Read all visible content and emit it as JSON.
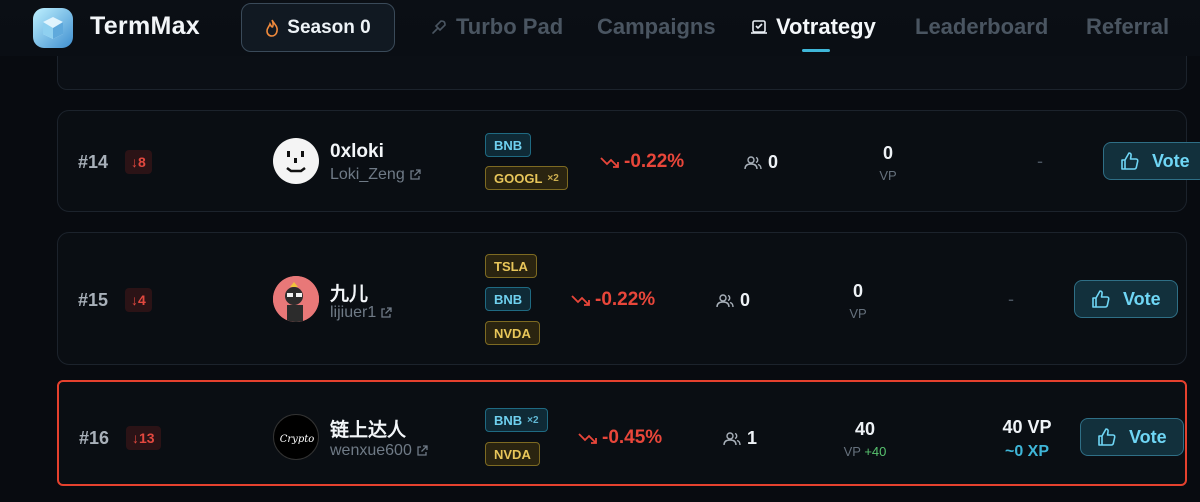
{
  "app": {
    "name": "TermMax"
  },
  "season": {
    "label": "Season 0"
  },
  "nav": [
    {
      "label": "Turbo Pad",
      "icon": "rocket-icon",
      "active": false
    },
    {
      "label": "Campaigns",
      "icon": "",
      "active": false
    },
    {
      "label": "Votrategy",
      "icon": "ballot-icon",
      "active": true
    },
    {
      "label": "Leaderboard",
      "icon": "",
      "active": false
    },
    {
      "label": "Referral",
      "icon": "",
      "active": false
    }
  ],
  "rows": [
    {
      "rank": "#14",
      "delta": "↓8",
      "name": "0xloki",
      "handle": "Loki_Zeng",
      "tags": [
        {
          "label": "BNB",
          "mult": "",
          "color": "blue"
        },
        {
          "label": "GOOGL",
          "mult": "×2",
          "color": "yellow"
        }
      ],
      "performance": "-0.22%",
      "voters": "0",
      "vp": "0",
      "vp_label": "VP",
      "vp_plus": "",
      "my_vp": "-",
      "my_xp": "",
      "vote_label": "Vote"
    },
    {
      "rank": "#15",
      "delta": "↓4",
      "name": "九儿",
      "handle": "lijiuer1",
      "tags": [
        {
          "label": "TSLA",
          "mult": "",
          "color": "yellow"
        },
        {
          "label": "BNB",
          "mult": "",
          "color": "blue"
        },
        {
          "label": "NVDA",
          "mult": "",
          "color": "yellow"
        }
      ],
      "performance": "-0.22%",
      "voters": "0",
      "vp": "0",
      "vp_label": "VP",
      "vp_plus": "",
      "my_vp": "-",
      "my_xp": "",
      "vote_label": "Vote"
    },
    {
      "rank": "#16",
      "delta": "↓13",
      "name": "链上达人",
      "handle": "wenxue600",
      "avatar_text": "Crypto",
      "tags": [
        {
          "label": "BNB",
          "mult": "×2",
          "color": "blue"
        },
        {
          "label": "NVDA",
          "mult": "",
          "color": "yellow"
        }
      ],
      "performance": "-0.45%",
      "voters": "1",
      "vp": "40",
      "vp_label": "VP",
      "vp_plus": "+40",
      "my_vp": "40 VP",
      "my_xp": "~0 XP",
      "vote_label": "Vote"
    }
  ],
  "colors": {
    "accent": "#3fb6d8",
    "negative": "#e8463a",
    "positive": "#58c36f",
    "highlight_border": "#e5412e"
  }
}
